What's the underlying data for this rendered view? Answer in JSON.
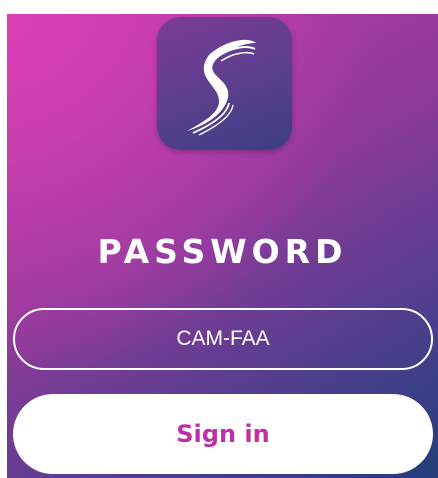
{
  "app": {
    "logo_icon": "stylized-s-logo-icon"
  },
  "login": {
    "title": "PASSWORD",
    "password_value": "CAM-FAA",
    "signin_label": "Sign in"
  },
  "colors": {
    "accent": "#c02fa8",
    "gradient_start": "#d93fb7",
    "gradient_end": "#233d7a"
  }
}
